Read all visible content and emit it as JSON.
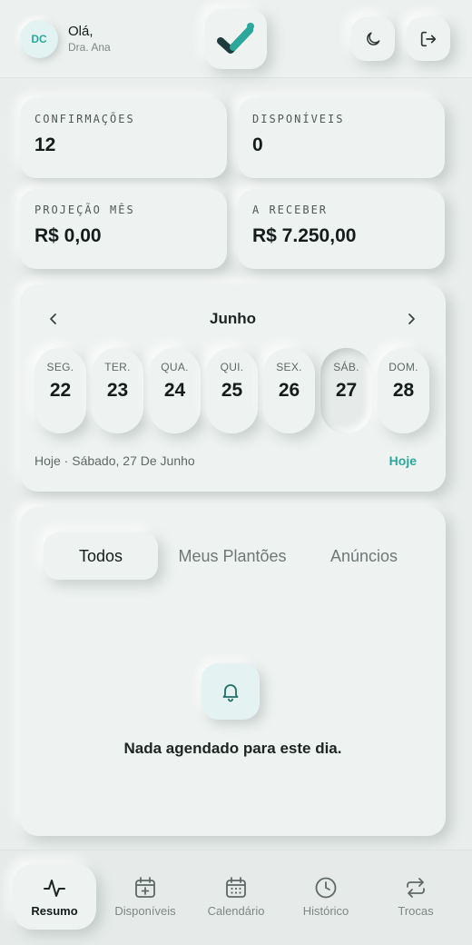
{
  "header": {
    "avatar_initials": "DC",
    "greeting": "Olá,",
    "user_name": "Dra. Ana"
  },
  "stats": [
    {
      "label": "CONFIRMAÇÕES",
      "value": "12"
    },
    {
      "label": "DISPONÍVEIS",
      "value": "0"
    },
    {
      "label": "PROJEÇÃO MÊS",
      "value": "R$ 0,00"
    },
    {
      "label": "A RECEBER",
      "value": "R$ 7.250,00"
    }
  ],
  "calendar": {
    "month": "Junho",
    "days": [
      {
        "name": "SEG.",
        "number": "22"
      },
      {
        "name": "TER.",
        "number": "23"
      },
      {
        "name": "QUA.",
        "number": "24"
      },
      {
        "name": "QUI.",
        "number": "25"
      },
      {
        "name": "SEX.",
        "number": "26"
      },
      {
        "name": "SÁB.",
        "number": "27",
        "selected": true
      },
      {
        "name": "DOM.",
        "number": "28"
      }
    ],
    "today_text": "Hoje · Sábado, 27 De Junho",
    "today_button": "Hoje"
  },
  "feed": {
    "tabs": [
      "Todos",
      "Meus Plantões",
      "Anúncios"
    ],
    "active_tab": "Todos",
    "empty_message": "Nada agendado para este dia."
  },
  "bottom_nav": {
    "items": [
      {
        "label": "Resumo",
        "icon": "activity-icon"
      },
      {
        "label": "Disponíveis",
        "icon": "calendar-plus-icon"
      },
      {
        "label": "Calendário",
        "icon": "calendar-grid-icon"
      },
      {
        "label": "Histórico",
        "icon": "clock-icon"
      },
      {
        "label": "Trocas",
        "icon": "swap-icon"
      }
    ],
    "active": "Resumo"
  },
  "colors": {
    "accent": "#2aa89c",
    "logo_dark": "#1f3b3b",
    "background": "#e9edeb"
  }
}
